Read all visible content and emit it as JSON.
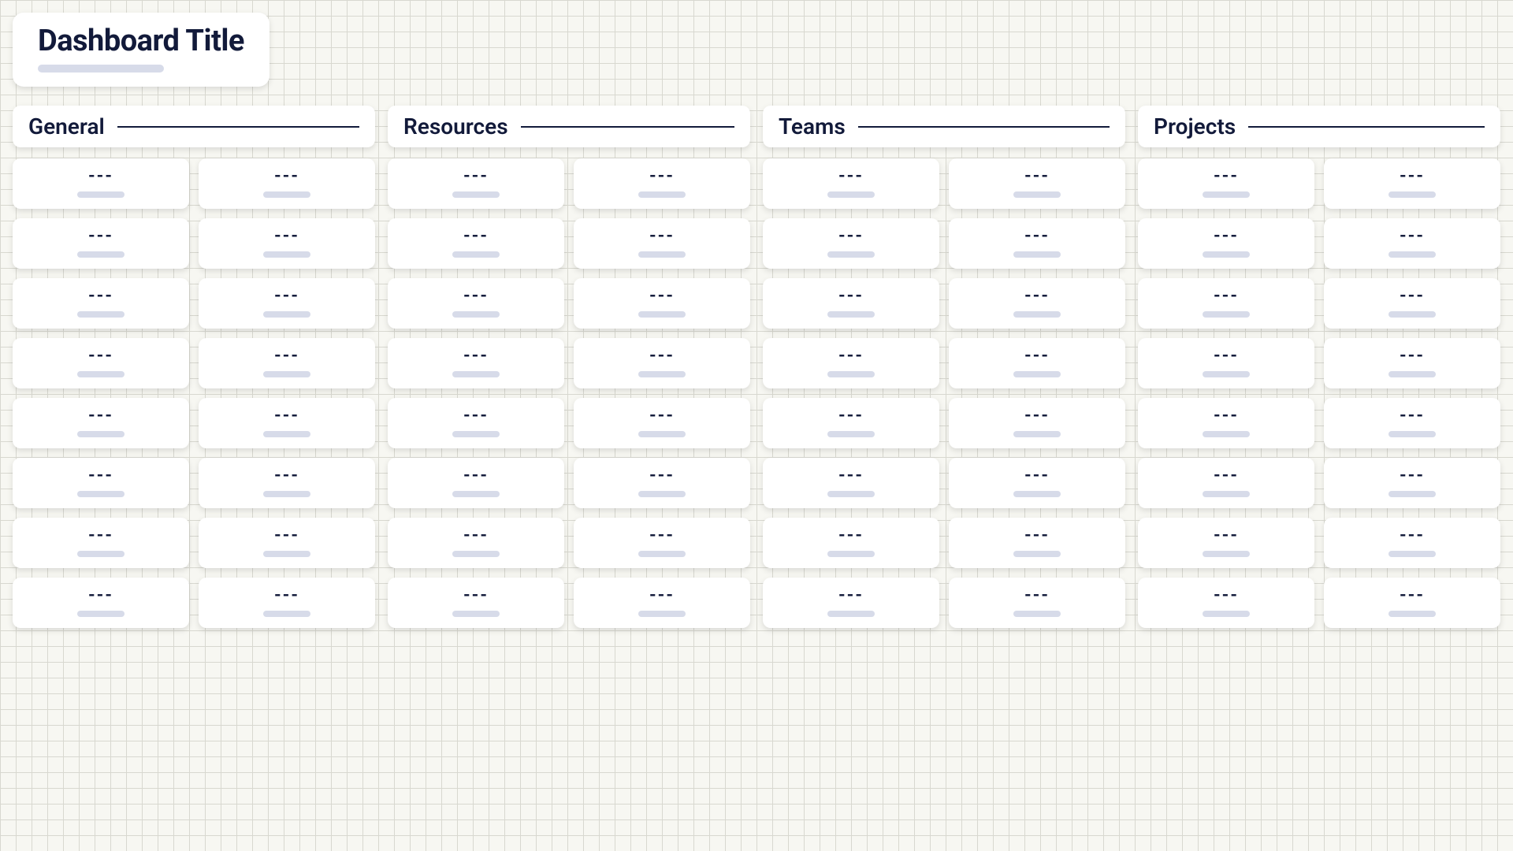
{
  "title": "Dashboard Title",
  "placeholder_value": "---",
  "sections": [
    {
      "label": "General"
    },
    {
      "label": "Resources"
    },
    {
      "label": "Teams"
    },
    {
      "label": "Projects"
    }
  ],
  "cards_per_section": 16
}
